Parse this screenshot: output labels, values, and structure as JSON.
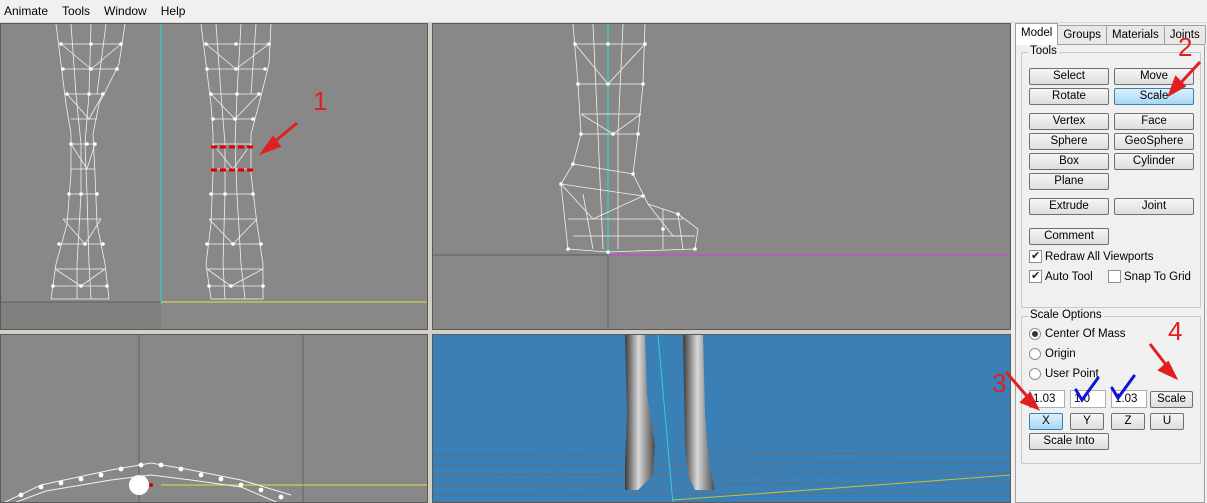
{
  "menubar": {
    "items": [
      "Animate",
      "Tools",
      "Window",
      "Help"
    ]
  },
  "panel": {
    "tabs": [
      "Model",
      "Groups",
      "Materials",
      "Joints"
    ],
    "active_tab": "Model",
    "tools": {
      "title": "Tools",
      "select": "Select",
      "move": "Move",
      "rotate": "Rotate",
      "scale": "Scale",
      "vertex": "Vertex",
      "face": "Face",
      "sphere": "Sphere",
      "geosphere": "GeoSphere",
      "box": "Box",
      "cylinder": "Cylinder",
      "plane": "Plane",
      "extrude": "Extrude",
      "joint": "Joint",
      "comment": "Comment",
      "redraw_all": "Redraw All Viewports",
      "auto_tool": "Auto Tool",
      "snap_to_grid": "Snap To Grid"
    },
    "scale_options": {
      "title": "Scale Options",
      "center_of_mass": "Center Of Mass",
      "origin": "Origin",
      "user_point": "User Point",
      "x_value": "1.03",
      "y_value": "1.0",
      "z_value": "1.03",
      "scale_button": "Scale",
      "x_button": "X",
      "y_button": "Y",
      "z_button": "Z",
      "u_button": "U",
      "scale_into": "Scale Into"
    }
  },
  "annotations": [
    "1",
    "2",
    "3",
    "4"
  ],
  "colors": {
    "viewport_bg": "#888888",
    "view3d_bg": "#3a7fb5",
    "annotation_red": "#e02020",
    "check_blue": "#1010e0"
  }
}
